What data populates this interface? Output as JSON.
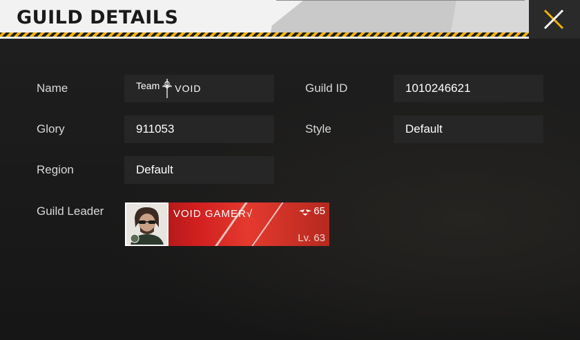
{
  "header": {
    "title": "GUILD DETAILS",
    "close_icon": "close-icon"
  },
  "fields": {
    "name_label": "Name",
    "name_team": "Team",
    "name_void": "VOID",
    "name_symbol_icon": "sword-icon",
    "guild_id_label": "Guild ID",
    "guild_id_value": "1010246621",
    "glory_label": "Glory",
    "glory_value": "911053",
    "style_label": "Style",
    "style_value": "Default",
    "region_label": "Region",
    "region_value": "Default",
    "leader_label": "Guild Leader"
  },
  "leader": {
    "name": "VOID GAMER√",
    "rank_icon": "rank-wings-icon",
    "rank_value": "65",
    "level": "Lv. 63"
  },
  "colors": {
    "accent": "#f4b400",
    "card_red": "#d11f1f",
    "field_bg": "#262626",
    "header_bg": "#f2f2f2"
  }
}
